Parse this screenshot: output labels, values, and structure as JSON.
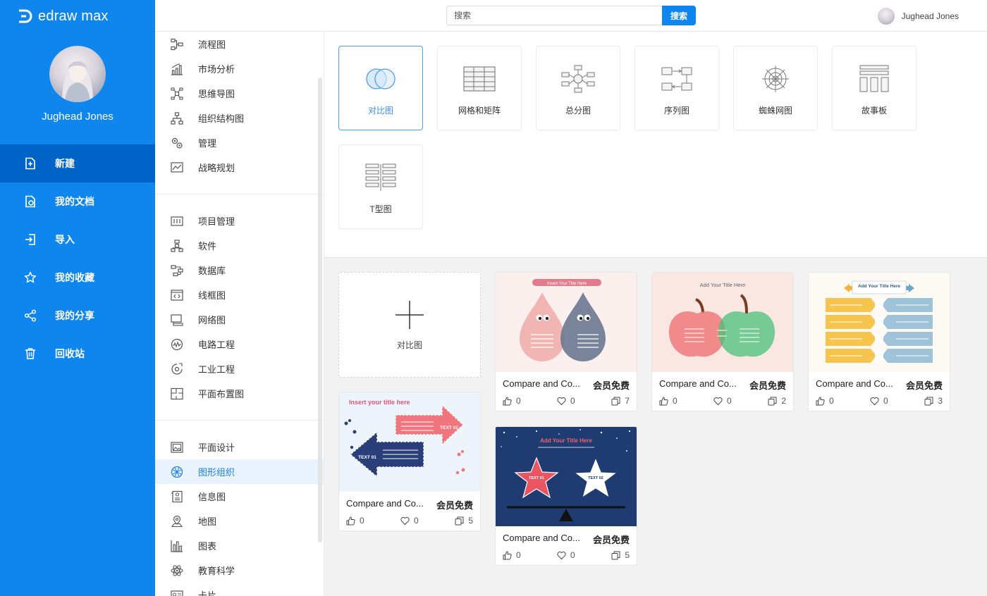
{
  "app": {
    "logo_text": "edraw max"
  },
  "user": {
    "name": "Jughead Jones"
  },
  "nav": [
    {
      "label": "新建",
      "icon": "new-file-icon",
      "active": true
    },
    {
      "label": "我的文档",
      "icon": "documents-icon"
    },
    {
      "label": "导入",
      "icon": "import-icon"
    },
    {
      "label": "我的收藏",
      "icon": "star-icon"
    },
    {
      "label": "我的分享",
      "icon": "share-icon"
    },
    {
      "label": "回收站",
      "icon": "trash-icon"
    }
  ],
  "search": {
    "placeholder": "搜索",
    "button_label": "搜索"
  },
  "categories": {
    "group1": [
      "流程图",
      "市场分析",
      "思维导图",
      "组织结构图",
      "管理",
      "战略规划"
    ],
    "group2": [
      "项目管理",
      "软件",
      "数据库",
      "线框图",
      "网络图",
      "电路工程",
      "工业工程",
      "平面布置图"
    ],
    "group3": [
      "平面设计",
      "图形组织",
      "信息图",
      "地图",
      "图表",
      "教育科学",
      "卡片"
    ],
    "active": "图形组织"
  },
  "diagram_types": [
    {
      "label": "对比图",
      "icon": "venn-icon",
      "active": true
    },
    {
      "label": "网格和矩阵",
      "icon": "grid-matrix-icon"
    },
    {
      "label": "总分图",
      "icon": "hub-spoke-icon"
    },
    {
      "label": "序列图",
      "icon": "sequence-icon"
    },
    {
      "label": "蜘蛛网图",
      "icon": "spider-web-icon"
    },
    {
      "label": "故事板",
      "icon": "storyboard-icon"
    },
    {
      "label": "T型图",
      "icon": "t-chart-icon"
    }
  ],
  "new_template": {
    "label": "对比图"
  },
  "templates": [
    {
      "title": "Compare and Co...",
      "price": "会员免费",
      "likes": "0",
      "favorites": "0",
      "copies": "7",
      "thumb_heading": "Insert Your Title Here"
    },
    {
      "title": "Compare and Co...",
      "price": "会员免费",
      "likes": "0",
      "favorites": "0",
      "copies": "2",
      "thumb_heading": "Add Your Title Here"
    },
    {
      "title": "Compare and Co...",
      "price": "会员免费",
      "likes": "0",
      "favorites": "0",
      "copies": "3",
      "thumb_heading": "Add Your Title Here"
    },
    {
      "title": "Compare and Co...",
      "price": "会员免费",
      "likes": "0",
      "favorites": "0",
      "copies": "5",
      "thumb_heading": "Insert your title here",
      "thumb_labels": [
        "TEXT 01",
        "TEXT 02"
      ]
    },
    {
      "title": "Compare and Co...",
      "price": "会员免费",
      "likes": "0",
      "favorites": "0",
      "copies": "5",
      "thumb_heading": "Add Your Title Here",
      "thumb_labels": [
        "TEXT 01",
        "TEXT 02"
      ]
    }
  ],
  "colors": {
    "brand": "#0f86ee",
    "nav_active": "#0063c8",
    "accent_text": "#1c7fe0"
  }
}
